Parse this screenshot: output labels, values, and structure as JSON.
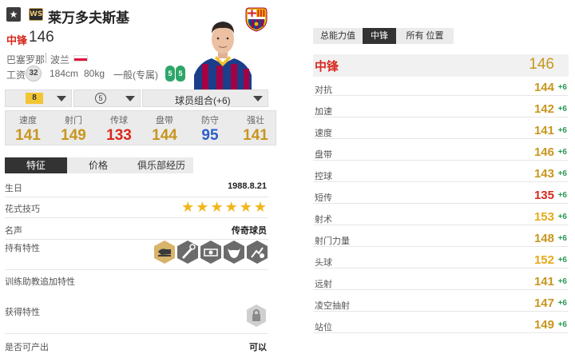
{
  "player": {
    "name": "莱万多夫斯基",
    "season_badge": "WS",
    "position": "中锋",
    "overall": "146",
    "club": "巴塞罗那",
    "nation": "波兰",
    "wage_label": "工资",
    "wage": "32",
    "height": "184cm",
    "weight": "80kg",
    "build": "一般(专属)",
    "left_foot": "5",
    "right_foot": "5"
  },
  "selectors": {
    "level": "8",
    "plus": "5",
    "chemistry": "球员组合(+6)"
  },
  "stats": [
    {
      "label": "速度",
      "value": "141",
      "color": "#c8961e"
    },
    {
      "label": "射门",
      "value": "149",
      "color": "#c8961e"
    },
    {
      "label": "传球",
      "value": "133",
      "color": "#d9281e"
    },
    {
      "label": "盘带",
      "value": "144",
      "color": "#c8961e"
    },
    {
      "label": "防守",
      "value": "95",
      "color": "#2b5fc9"
    },
    {
      "label": "强壮",
      "value": "141",
      "color": "#c8961e"
    }
  ],
  "info_tabs": [
    "特征",
    "价格",
    "俱乐部经历"
  ],
  "info": {
    "birthday_label": "生日",
    "birthday": "1988.8.21",
    "skill_label": "花式技巧",
    "skill_stars": 6,
    "fame_label": "名声",
    "fame": "传奇球员",
    "traits_label": "持有特性",
    "coach_label": "训练助教追加特性",
    "acquired_label": "获得特性",
    "producible_label": "是否可产出",
    "producible": "可以"
  },
  "right_tabs": [
    "总能力值",
    "中锋",
    "所有 位置"
  ],
  "position_rating": {
    "label": "中锋",
    "value": "146"
  },
  "attributes": [
    {
      "label": "对抗",
      "value": "144",
      "bonus": "+6",
      "color": "#c8961e"
    },
    {
      "label": "加速",
      "value": "142",
      "bonus": "+6",
      "color": "#c8961e"
    },
    {
      "label": "速度",
      "value": "141",
      "bonus": "+6",
      "color": "#c8961e"
    },
    {
      "label": "盘带",
      "value": "146",
      "bonus": "+6",
      "color": "#c8961e"
    },
    {
      "label": "控球",
      "value": "143",
      "bonus": "+6",
      "color": "#c8961e"
    },
    {
      "label": "短传",
      "value": "135",
      "bonus": "+6",
      "color": "#d9281e"
    },
    {
      "label": "射术",
      "value": "153",
      "bonus": "+6",
      "color": "#e6a817"
    },
    {
      "label": "射门力量",
      "value": "148",
      "bonus": "+6",
      "color": "#c8961e"
    },
    {
      "label": "头球",
      "value": "152",
      "bonus": "+6",
      "color": "#e6a817"
    },
    {
      "label": "远射",
      "value": "141",
      "bonus": "+6",
      "color": "#c8961e"
    },
    {
      "label": "凌空抽射",
      "value": "147",
      "bonus": "+6",
      "color": "#c8961e"
    },
    {
      "label": "站位",
      "value": "149",
      "bonus": "+6",
      "color": "#c8961e"
    }
  ]
}
